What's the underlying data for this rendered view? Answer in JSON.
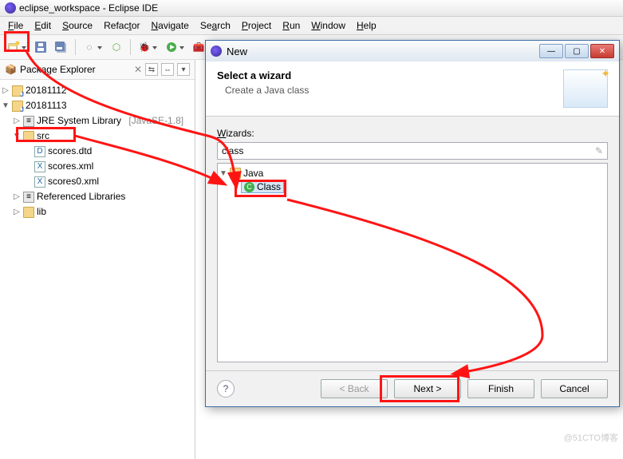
{
  "window": {
    "title": "eclipse_workspace - Eclipse IDE"
  },
  "menubar": [
    "File",
    "Edit",
    "Source",
    "Refactor",
    "Navigate",
    "Search",
    "Project",
    "Run",
    "Window",
    "Help"
  ],
  "packageExplorer": {
    "title": "Package Explorer",
    "tree": {
      "p1": "20181112",
      "p2": "20181113",
      "jre": "JRE System Library",
      "jre_hint": "[JavaSE-1.8]",
      "src": "src",
      "f1": "scores.dtd",
      "f2": "scores.xml",
      "f3": "scores0.xml",
      "ref": "Referenced Libraries",
      "lib": "lib"
    }
  },
  "dialog": {
    "title": "New",
    "heading": "Select a wizard",
    "sub": "Create a Java class",
    "wizards_label": "Wizards:",
    "filter_value": "class",
    "tree": {
      "java": "Java",
      "class": "Class"
    },
    "buttons": {
      "back": "< Back",
      "next": "Next >",
      "finish": "Finish",
      "cancel": "Cancel"
    }
  },
  "watermark": "@51CTO博客"
}
